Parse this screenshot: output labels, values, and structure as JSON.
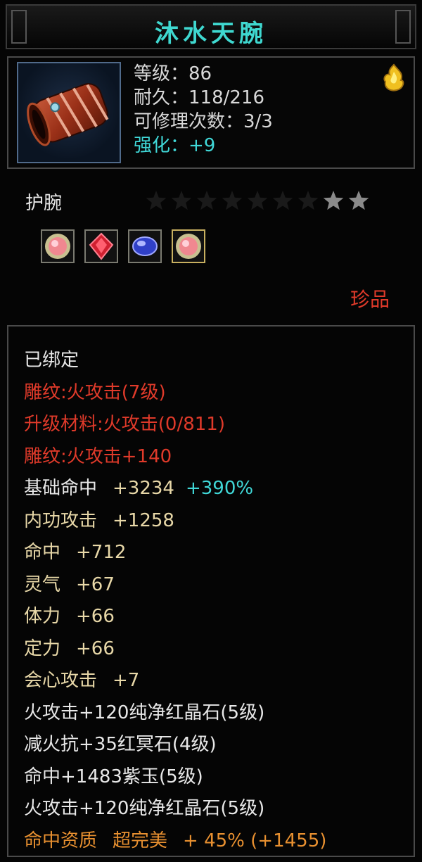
{
  "item": {
    "name": "沐水天腕",
    "stats": {
      "level": "等级：86",
      "durability": "耐久：118/216",
      "repair": "可修理次数：3/3",
      "enhance": "强化：+9"
    },
    "type": "护腕",
    "star_count": 2,
    "star_total": 9,
    "gems": [
      "pink-gem-icon",
      "red-crystal-icon",
      "purple-jade-icon",
      "pink-gem-icon"
    ],
    "quality": "珍品",
    "bound": "已绑定",
    "engrave": {
      "l1": "雕纹:火攻击(7级)",
      "l2": "升级材料:火攻击(0/811)",
      "l3": "雕纹:火攻击+140"
    },
    "attrs": {
      "a1_name": "基础命中",
      "a1_val": "+3234",
      "a1_pct": "+390%",
      "a2_name": "内功攻击",
      "a2_val": "+1258",
      "a3_name": "命中",
      "a3_val": "+712",
      "a4_name": "灵气",
      "a4_val": "+67",
      "a5_name": "体力",
      "a5_val": "+66",
      "a6_name": "定力",
      "a6_val": "+66",
      "a7_name": "会心攻击",
      "a7_val": "+7"
    },
    "gem_lines": {
      "g1": "火攻击+120纯净红晶石(5级)",
      "g2": "减火抗+35红冥石(4级)",
      "g3": "命中+1483紫玉(5级)",
      "g4": "火攻击+120纯净红晶石(5级)"
    },
    "aptitude": {
      "label": "命中资质",
      "grade": "超完美",
      "value": "+ 45% (+1455)"
    },
    "colors": {
      "title": "#3fd8d0",
      "red": "#e03a2a",
      "cyan": "#40d8d8",
      "gold": "#e8d8a8",
      "orange": "#e89030"
    }
  }
}
